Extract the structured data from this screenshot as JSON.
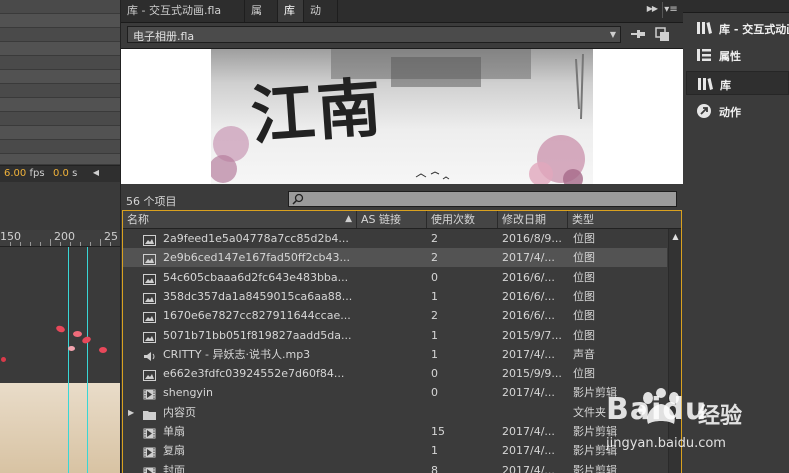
{
  "left_panel": {
    "fps_value": "6.00",
    "fps_unit": "fps",
    "time_value": "0.0",
    "time_unit": "s",
    "ruler_labels": [
      "150",
      "200",
      "25"
    ]
  },
  "library": {
    "tabs": [
      {
        "label": "库 - 交互式动画.fla",
        "active": false
      },
      {
        "label": "属性",
        "active": false
      },
      {
        "label": "库",
        "active": true
      },
      {
        "label": "动作",
        "active": false
      }
    ],
    "document": "电子相册.fla",
    "preview_text": "江南",
    "item_count": "56 个项目",
    "search_placeholder": "",
    "columns": [
      "名称",
      "AS 链接",
      "使用次数",
      "修改日期",
      "类型"
    ],
    "rows": [
      {
        "icon": "bitmap-icon",
        "name": "2a9feed1e5a04778a7cc85d2b4...",
        "uses": "2",
        "date": "2016/8/9...",
        "type": "位图",
        "selected": false
      },
      {
        "icon": "bitmap-icon",
        "name": "2e9b6ced147e167fad50ff2cb43...",
        "uses": "2",
        "date": "2017/4/...",
        "type": "位图",
        "selected": true
      },
      {
        "icon": "bitmap-icon",
        "name": "54c605cbaaa6d2fc643e483bba...",
        "uses": "0",
        "date": "2016/6/...",
        "type": "位图",
        "selected": false
      },
      {
        "icon": "bitmap-icon",
        "name": "358dc357da1a8459015ca6aa88...",
        "uses": "1",
        "date": "2016/6/...",
        "type": "位图",
        "selected": false
      },
      {
        "icon": "bitmap-icon",
        "name": "1670e6e7827cc827911644ccae...",
        "uses": "2",
        "date": "2016/6/...",
        "type": "位图",
        "selected": false
      },
      {
        "icon": "bitmap-icon",
        "name": "5071b71bb051f819827aadd5da...",
        "uses": "1",
        "date": "2015/9/7...",
        "type": "位图",
        "selected": false
      },
      {
        "icon": "sound-icon",
        "name": "CRITTY - 异妖志·说书人.mp3",
        "uses": "1",
        "date": "2017/4/...",
        "type": "声音",
        "selected": false
      },
      {
        "icon": "bitmap-icon",
        "name": "e662e3fdfc03924552e7d60f84...",
        "uses": "0",
        "date": "2015/9/9...",
        "type": "位图",
        "selected": false
      },
      {
        "icon": "movieclip-icon",
        "name": "shengyin",
        "uses": "0",
        "date": "2017/4/...",
        "type": "影片剪辑",
        "selected": false
      },
      {
        "icon": "folder-icon",
        "name": "内容页",
        "uses": "",
        "date": "",
        "type": "文件夹",
        "selected": false,
        "folder": true
      },
      {
        "icon": "movieclip-icon",
        "name": "单扇",
        "uses": "15",
        "date": "2017/4/...",
        "type": "影片剪辑",
        "selected": false
      },
      {
        "icon": "movieclip-icon",
        "name": "复扇",
        "uses": "1",
        "date": "2017/4/...",
        "type": "影片剪辑",
        "selected": false
      },
      {
        "icon": "movieclip-icon",
        "name": "封面",
        "uses": "8",
        "date": "2017/4/...",
        "type": "影片剪辑",
        "selected": false
      }
    ]
  },
  "dock": {
    "items": [
      {
        "label": "库 - 交互式动画",
        "icon": "library-icon",
        "active": false
      },
      {
        "label": "属性",
        "icon": "properties-icon",
        "active": false
      },
      {
        "label": "库",
        "icon": "library-icon",
        "active": true
      },
      {
        "label": "动作",
        "icon": "actions-icon",
        "active": false
      }
    ]
  },
  "watermark": {
    "brand": "Baidu",
    "cn": "经验",
    "url": "jingyan.baidu.com"
  },
  "colors": {
    "accent_orange": "#f0b23a",
    "table_border": "#d9a11f",
    "guide_cyan": "#39d6d6"
  }
}
